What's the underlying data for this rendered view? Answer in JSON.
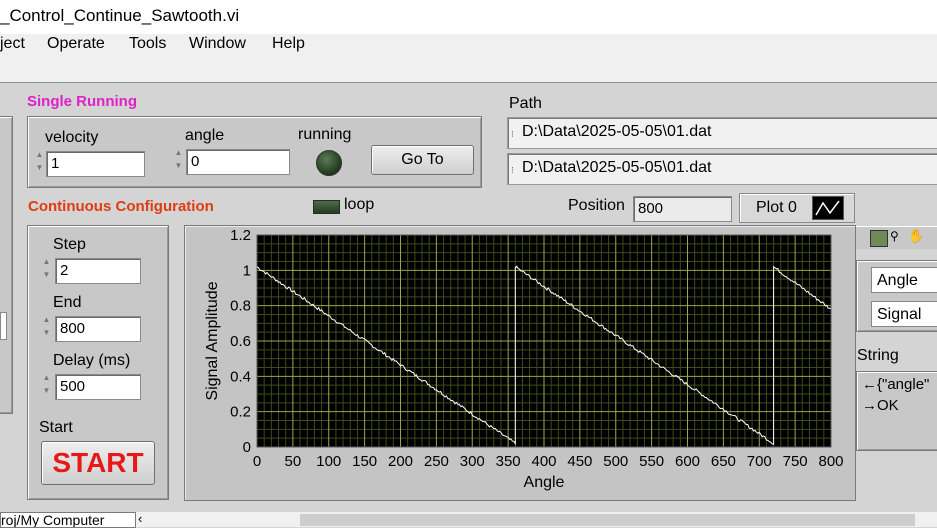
{
  "window": {
    "title": "_Control_Continue_Sawtooth.vi"
  },
  "menu": [
    "ject",
    "Operate",
    "Tools",
    "Window",
    "Help"
  ],
  "single_running": {
    "title": "Single Running",
    "title_color": "#e020c8",
    "velocity_label": "velocity",
    "velocity_value": "1",
    "angle_label": "angle",
    "angle_value": "0",
    "running_label": "running",
    "goto_label": "Go To"
  },
  "path": {
    "label": "Path",
    "value1": "D:\\Data\\2025-05-05\\01.dat",
    "value2": "D:\\Data\\2025-05-05\\01.dat"
  },
  "continuous": {
    "title": "Continuous Configuration",
    "title_color": "#e03c10",
    "loop_label": "loop",
    "step_label": "Step",
    "step_value": "2",
    "end_label": "End",
    "end_value": "800",
    "delay_label": "Delay (ms)",
    "delay_value": "500",
    "start_label": "Start",
    "start_button": "START",
    "start_color": "#e81818"
  },
  "position": {
    "label": "Position",
    "value": "800"
  },
  "plot_legend": {
    "label": "Plot 0"
  },
  "cursor_panel": {
    "x_name": "Angle",
    "y_name": "Signal",
    "string_label": "String",
    "string_line1": "←{\"angle\"",
    "string_line2": "→OK"
  },
  "status_bar": {
    "path_text": "roj/My Computer"
  },
  "chart_data": {
    "type": "line",
    "xlabel": "Angle",
    "ylabel": "Signal Amplitude",
    "xlim": [
      0,
      800
    ],
    "ylim": [
      0,
      1.2
    ],
    "x_ticks": [
      0,
      50,
      100,
      150,
      200,
      250,
      300,
      350,
      400,
      450,
      500,
      550,
      600,
      650,
      700,
      750,
      800
    ],
    "y_ticks": [
      0,
      0.2,
      0.4,
      0.6,
      0.8,
      1,
      1.2
    ],
    "grid": true,
    "colors": {
      "background": "#000000",
      "grid_major": "#9aa84a",
      "grid_minor": "#3f4a1a",
      "line": "#ffffff"
    },
    "series": [
      {
        "x": [
          0,
          360,
          360,
          720,
          720,
          800
        ],
        "y": [
          1.02,
          0.02,
          1.02,
          0.02,
          1.02,
          0.78
        ]
      }
    ]
  }
}
